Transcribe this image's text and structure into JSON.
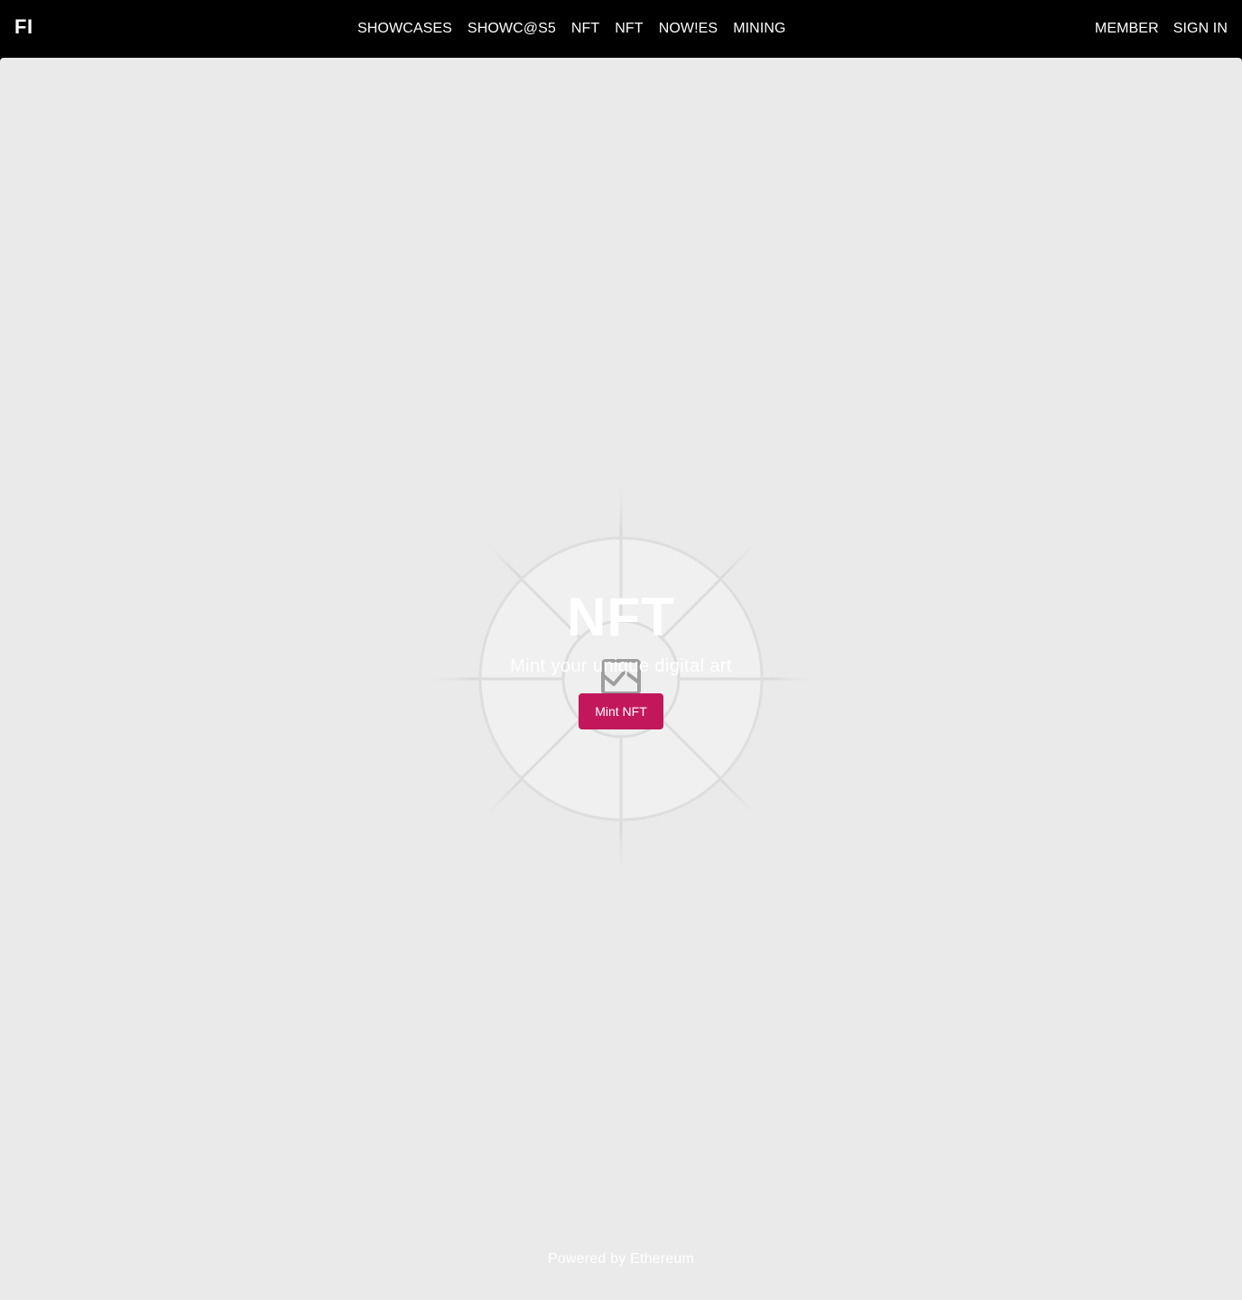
{
  "header": {
    "logo": "FI",
    "nav": [
      "SHOWCASES",
      "SHOWC@S5",
      "NFT",
      "NFT",
      "NOW!ES",
      "MINING"
    ],
    "auth": {
      "member": "MEMBER",
      "sign_in": "SIGN IN"
    }
  },
  "hero": {
    "title": "NFT",
    "subtitle": "Mint your unique digital art",
    "button_label": "Mint NFT",
    "illustration_icon": "broken-image-icon"
  },
  "footer": {
    "text": "Powered by Ethereum"
  },
  "colors": {
    "header_bg": "#000000",
    "page_bg": "#eaeaea",
    "accent": "#c2185b",
    "text_light": "#ffffff",
    "rays": "#d6d6d6",
    "icon_gray": "#9e9e9e"
  }
}
